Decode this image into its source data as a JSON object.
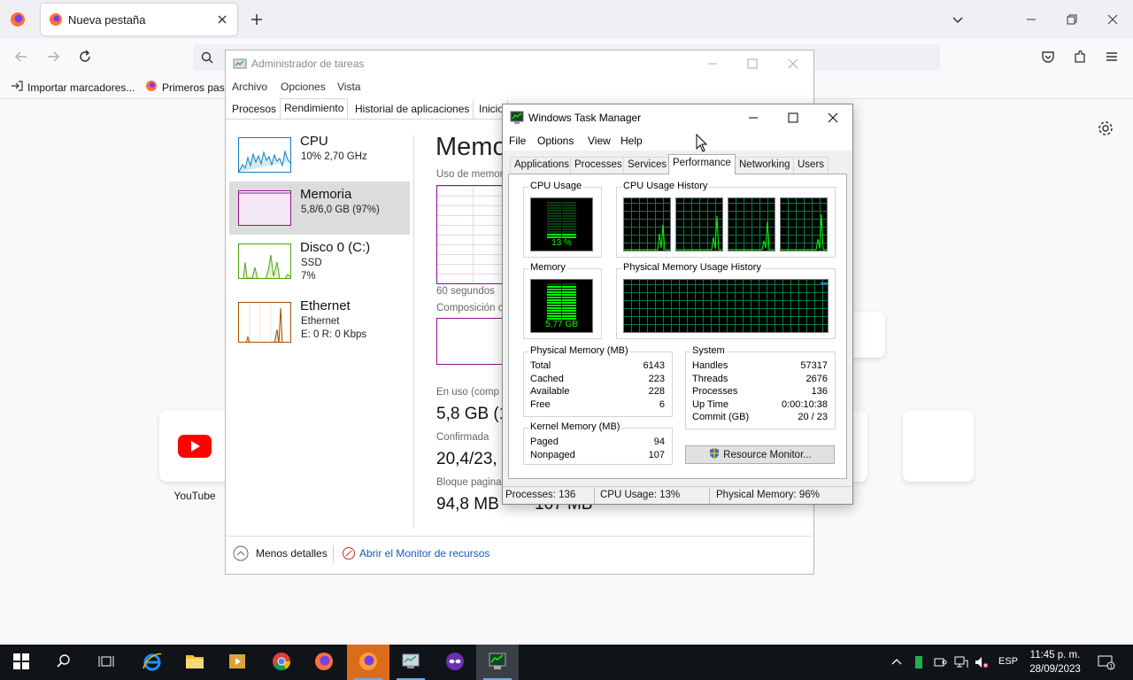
{
  "firefox": {
    "tab_title": "Nueva pestaña",
    "bookmarks": [
      "Importar marcadores...",
      "Primeros pasos"
    ],
    "tiles": [
      {
        "label": "YouTube"
      }
    ]
  },
  "tm_es": {
    "title": "Administrador de tareas",
    "menu": [
      "Archivo",
      "Opciones",
      "Vista"
    ],
    "tabs": [
      "Procesos",
      "Rendimiento",
      "Historial de aplicaciones",
      "Inicio"
    ],
    "items": [
      {
        "name": "CPU",
        "sub1": "10% 2,70 GHz",
        "sub2": "",
        "sub3": ""
      },
      {
        "name": "Memoria",
        "sub1": "5,8/6,0 GB (97%)",
        "sub2": "",
        "sub3": ""
      },
      {
        "name": "Disco 0 (C:)",
        "sub1": "SSD",
        "sub2": "7%",
        "sub3": ""
      },
      {
        "name": "Ethernet",
        "sub1": "Ethernet",
        "sub2": "E: 0 R: 0 Kbps",
        "sub3": ""
      }
    ],
    "heading": "Memo",
    "usage_label": "Uso de memor",
    "seconds_label": "60 segundos",
    "composition_label": "Composición c",
    "in_use_label": "En uso (comp",
    "in_use_value": "5,8 GB (1",
    "committed_label": "Confirmada",
    "committed_value": "20,4/23,",
    "paged_pool_label": "Bloque pagina",
    "paged_pool_value": "94,8 MB",
    "nonpaged_value": "107 MB",
    "fewer_details": "Menos detalles",
    "open_resmon": "Abrir el Monitor de recursos"
  },
  "wtm": {
    "title": "Windows Task Manager",
    "menu": [
      "File",
      "Options",
      "View",
      "Help"
    ],
    "tabs": [
      "Applications",
      "Processes",
      "Services",
      "Performance",
      "Networking",
      "Users"
    ],
    "active_tab": "Performance",
    "cpu_usage_label": "CPU Usage",
    "cpu_usage_value": "13 %",
    "cpu_usage_fraction": 0.13,
    "cpu_history_label": "CPU Usage History",
    "memory_label": "Memory",
    "memory_value": "5,77 GB",
    "memory_fraction": 0.96,
    "phys_history_label": "Physical Memory Usage History",
    "physical_memory": {
      "label": "Physical Memory (MB)",
      "rows": [
        {
          "k": "Total",
          "v": "6143"
        },
        {
          "k": "Cached",
          "v": "223"
        },
        {
          "k": "Available",
          "v": "228"
        },
        {
          "k": "Free",
          "v": "6"
        }
      ]
    },
    "kernel_memory": {
      "label": "Kernel Memory (MB)",
      "rows": [
        {
          "k": "Paged",
          "v": "94"
        },
        {
          "k": "Nonpaged",
          "v": "107"
        }
      ]
    },
    "system": {
      "label": "System",
      "rows": [
        {
          "k": "Handles",
          "v": "57317"
        },
        {
          "k": "Threads",
          "v": "2676"
        },
        {
          "k": "Processes",
          "v": "136"
        },
        {
          "k": "Up Time",
          "v": "0:00:10:38"
        },
        {
          "k": "Commit (GB)",
          "v": "20 / 23"
        }
      ]
    },
    "resource_monitor_button": "Resource Monitor...",
    "status": {
      "processes": "Processes: 136",
      "cpu": "CPU Usage: 13%",
      "memory": "Physical Memory: 96%"
    }
  },
  "taskbar": {
    "language": "ESP",
    "time": "11:45 p. m.",
    "date": "28/09/2023"
  },
  "colors": {
    "meter_green": "#00ff00",
    "cpu_graph": "#117dbb",
    "memory_graph": "#8b0e8b",
    "disk_graph": "#4da60c",
    "ethernet_graph": "#a74f01",
    "taskbar_bg": "#101318"
  }
}
